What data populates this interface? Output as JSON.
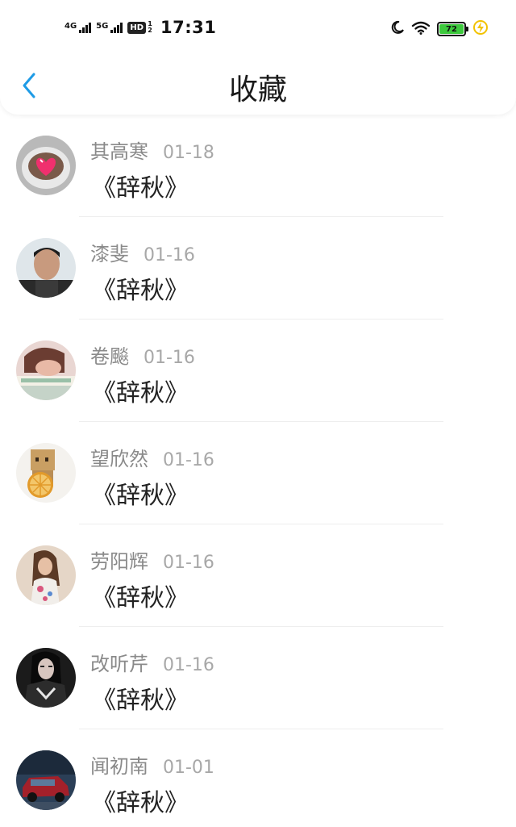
{
  "status_bar": {
    "signal_1": "4G",
    "signal_2": "5G",
    "hd_label": "HD",
    "hd_sub": "1 2",
    "time": "17:31",
    "battery_level": "72",
    "battery_color": "#3dc93d",
    "icons": [
      "moon-icon",
      "wifi-icon",
      "battery-icon",
      "charging-icon"
    ]
  },
  "nav": {
    "back_icon": "chevron-left-icon",
    "title": "收藏",
    "accent": "#1e9be6"
  },
  "favorites": [
    {
      "name": "其高寒",
      "date": "01-18",
      "content": "《辞秋》"
    },
    {
      "name": "漆斐",
      "date": "01-16",
      "content": "《辞秋》"
    },
    {
      "name": "卷飈",
      "date": "01-16",
      "content": "《辞秋》"
    },
    {
      "name": "望欣然",
      "date": "01-16",
      "content": "《辞秋》"
    },
    {
      "name": "劳阳辉",
      "date": "01-16",
      "content": "《辞秋》"
    },
    {
      "name": "改听芹",
      "date": "01-16",
      "content": "《辞秋》"
    },
    {
      "name": "闻初南",
      "date": "01-01",
      "content": "《辞秋》"
    }
  ]
}
